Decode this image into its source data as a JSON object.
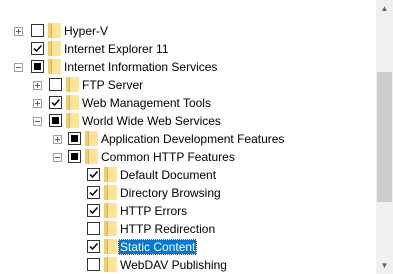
{
  "tree": {
    "items": [
      {
        "label": "Hyper-V",
        "expander": "plus",
        "check": "unchecked",
        "level": 0
      },
      {
        "label": "Internet Explorer 11",
        "expander": "none",
        "check": "checked",
        "level": 0
      },
      {
        "label": "Internet Information Services",
        "expander": "minus",
        "check": "partial",
        "level": 0
      },
      {
        "label": "FTP Server",
        "expander": "plus",
        "check": "unchecked",
        "level": 1
      },
      {
        "label": "Web Management Tools",
        "expander": "plus",
        "check": "checked",
        "level": 1
      },
      {
        "label": "World Wide Web Services",
        "expander": "minus",
        "check": "partial",
        "level": 1
      },
      {
        "label": "Application Development Features",
        "expander": "plus",
        "check": "partial",
        "level": 2
      },
      {
        "label": "Common HTTP Features",
        "expander": "minus",
        "check": "partial",
        "level": 2
      },
      {
        "label": "Default Document",
        "expander": "none",
        "check": "checked",
        "level": 3
      },
      {
        "label": "Directory Browsing",
        "expander": "none",
        "check": "checked",
        "level": 3
      },
      {
        "label": "HTTP Errors",
        "expander": "none",
        "check": "checked",
        "level": 3
      },
      {
        "label": "HTTP Redirection",
        "expander": "none",
        "check": "unchecked",
        "level": 3
      },
      {
        "label": "Static Content",
        "expander": "none",
        "check": "checked",
        "level": 3,
        "selected": true
      },
      {
        "label": "WebDAV Publishing",
        "expander": "none",
        "check": "unchecked",
        "level": 3
      }
    ]
  },
  "scrollbar": {
    "up_icon": "scroll-up-arrow",
    "down_icon": "scroll-down-arrow"
  },
  "colors": {
    "selection": "#0078d7",
    "folder": "#ffe497"
  }
}
